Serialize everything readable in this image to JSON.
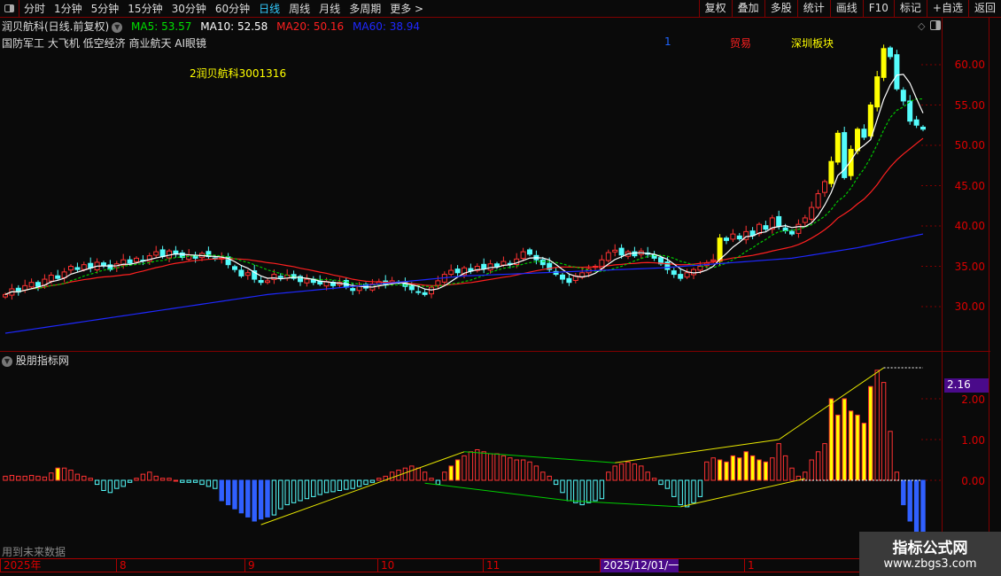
{
  "toolbar": {
    "periods": [
      "分时",
      "1分钟",
      "5分钟",
      "15分钟",
      "30分钟",
      "60分钟",
      "日线",
      "周线",
      "月线",
      "多周期",
      "更多 >"
    ],
    "active_period": "日线",
    "actions": [
      "复权",
      "叠加",
      "多股",
      "统计",
      "画线",
      "F10",
      "标记",
      "+自选",
      "返回"
    ]
  },
  "legend": {
    "title": "润贝航科(日线.前复权)",
    "ma5": "MA5: 53.57",
    "ma10": "MA10: 52.58",
    "ma20": "MA20: 50.16",
    "ma60": "MA60: 38.94",
    "concepts": "国防军工 大飞机 低空经济 商业航天 AI眼镜",
    "tag_number": "1",
    "tag_trade": "贸易",
    "tag_board": "深圳板块",
    "annotation": "2润贝航科3001316"
  },
  "colors": {
    "up": "#ff3232",
    "down": "#54fcfc",
    "ma5": "#ffffff",
    "ma10": "#00c800",
    "ma20": "#ff2020",
    "ma60": "#1e28ff",
    "accent": "#33ccff",
    "grid": "#800000"
  },
  "indicator": {
    "title": "股朋指标网",
    "current_value": "2.16",
    "footer_note": "用到未来数据"
  },
  "time_axis": [
    "2025年",
    "8",
    "9",
    "10",
    "11",
    "2025/12/01/一",
    "1"
  ],
  "watermark": {
    "line1": "指标公式网",
    "line2": "www.zbgs3.com"
  },
  "chart_data": {
    "type": "candlestick",
    "price_axis": {
      "ticks": [
        "60.00",
        "55.00",
        "50.00",
        "45.00",
        "40.00",
        "35.00",
        "30.00"
      ],
      "ylim": [
        30,
        60
      ]
    },
    "closes": [
      31.5,
      32.2,
      31.8,
      32.6,
      33.0,
      32.5,
      33.4,
      33.9,
      33.5,
      34.3,
      35.0,
      34.6,
      35.2,
      34.8,
      35.5,
      35.1,
      34.6,
      35.3,
      35.8,
      35.4,
      36.0,
      35.7,
      36.3,
      36.8,
      36.2,
      36.9,
      36.5,
      36.1,
      36.4,
      36.0,
      36.6,
      36.2,
      35.9,
      36.0,
      35.2,
      34.6,
      33.8,
      34.2,
      33.4,
      33.0,
      33.2,
      34.0,
      33.6,
      33.9,
      33.5,
      33.1,
      33.4,
      33.0,
      32.8,
      33.1,
      32.6,
      33.0,
      32.4,
      32.0,
      32.6,
      32.3,
      32.8,
      33.1,
      32.7,
      33.2,
      33.0,
      32.5,
      32.1,
      31.8,
      31.5,
      32.4,
      33.2,
      34.0,
      34.5,
      34.2,
      34.8,
      34.4,
      35.0,
      34.7,
      35.3,
      35.0,
      35.6,
      35.3,
      35.9,
      36.8,
      36.5,
      35.8,
      35.2,
      34.6,
      34.0,
      33.4,
      33.0,
      33.8,
      34.2,
      34.7,
      35.0,
      35.8,
      36.7,
      37.0,
      36.4,
      36.8,
      36.3,
      36.9,
      36.5,
      36.0,
      35.3,
      34.6,
      34.0,
      33.5,
      34.2,
      34.6,
      35.0,
      35.4,
      35.8,
      38.5,
      38.2,
      39.0,
      38.4,
      39.3,
      38.8,
      40.2,
      39.6,
      41.0,
      40.0,
      39.4,
      39.0,
      40.2,
      41.0,
      42.3,
      44.0,
      45.5,
      48.0,
      51.5,
      46.0,
      49.5,
      52.0,
      51.0,
      55.0,
      58.5,
      62.0,
      61.0,
      57.0,
      55.5,
      53.0,
      52.5,
      52.0
    ],
    "ma60_keypoints": [
      [
        0,
        26.7
      ],
      [
        40,
        31.5
      ],
      [
        70,
        33.8
      ],
      [
        100,
        34.8
      ],
      [
        120,
        36.0
      ],
      [
        130,
        37.3
      ],
      [
        140,
        39.0
      ]
    ],
    "oscillator": {
      "ticks": [
        "2.00",
        "1.00",
        "0.00"
      ],
      "ylim": [
        -1.4,
        2.9
      ],
      "values": [
        0.1,
        0.12,
        0.1,
        0.1,
        0.12,
        0.1,
        0.08,
        0.18,
        0.3,
        0.3,
        0.25,
        0.15,
        0.1,
        0.05,
        -0.1,
        -0.25,
        -0.3,
        -0.2,
        -0.15,
        -0.05,
        0.05,
        0.15,
        0.2,
        0.1,
        0.05,
        0.05,
        0.0,
        -0.05,
        -0.05,
        -0.05,
        -0.1,
        -0.15,
        -0.2,
        -0.5,
        -0.6,
        -0.7,
        -0.8,
        -0.9,
        -1.0,
        -0.95,
        -0.9,
        -0.85,
        -0.7,
        -0.6,
        -0.55,
        -0.5,
        -0.45,
        -0.4,
        -0.35,
        -0.3,
        -0.28,
        -0.25,
        -0.22,
        -0.2,
        -0.15,
        -0.1,
        -0.05,
        0.05,
        0.1,
        0.2,
        0.25,
        0.3,
        0.35,
        0.3,
        0.2,
        0.05,
        -0.1,
        0.2,
        0.35,
        0.5,
        0.6,
        0.7,
        0.75,
        0.7,
        0.65,
        0.65,
        0.6,
        0.55,
        0.5,
        0.5,
        0.45,
        0.35,
        0.2,
        0.1,
        -0.1,
        -0.3,
        -0.5,
        -0.55,
        -0.6,
        -0.55,
        -0.5,
        -0.45,
        0.2,
        0.35,
        0.4,
        0.45,
        0.4,
        0.35,
        0.2,
        0.05,
        -0.1,
        -0.2,
        -0.4,
        -0.6,
        -0.65,
        -0.55,
        -0.4,
        0.45,
        0.55,
        0.5,
        0.45,
        0.6,
        0.55,
        0.7,
        0.6,
        0.5,
        0.45,
        0.55,
        0.9,
        0.6,
        0.3,
        0.1,
        0.2,
        0.5,
        0.7,
        0.9,
        2.0,
        1.6,
        2.0,
        1.7,
        1.6,
        1.4,
        2.3,
        2.7,
        2.4,
        1.2,
        0.2,
        -0.6,
        -1.0,
        -1.3,
        -1.3
      ],
      "yellow_indices": [
        8,
        68,
        69,
        109,
        110,
        111,
        112,
        113,
        114,
        115,
        116,
        126,
        127,
        128,
        129,
        130,
        131,
        132
      ],
      "blue_indices": [
        33,
        34,
        35,
        36,
        37,
        38,
        39,
        40,
        137,
        138,
        139,
        140
      ],
      "yellow_lines": [
        [
          [
            39,
            -1.09
          ],
          [
            70,
            0.7
          ]
        ],
        [
          [
            93,
            0.43
          ],
          [
            118,
            1.0
          ],
          [
            134,
            2.76
          ]
        ],
        [
          [
            103,
            -0.65
          ],
          [
            122,
            0.04
          ]
        ]
      ],
      "green_lines": [
        [
          [
            70,
            0.7
          ],
          [
            93,
            0.43
          ]
        ],
        [
          [
            64,
            -0.07
          ],
          [
            86,
            -0.5
          ],
          [
            103,
            -0.65
          ]
        ]
      ],
      "peak_level": 2.76
    }
  }
}
